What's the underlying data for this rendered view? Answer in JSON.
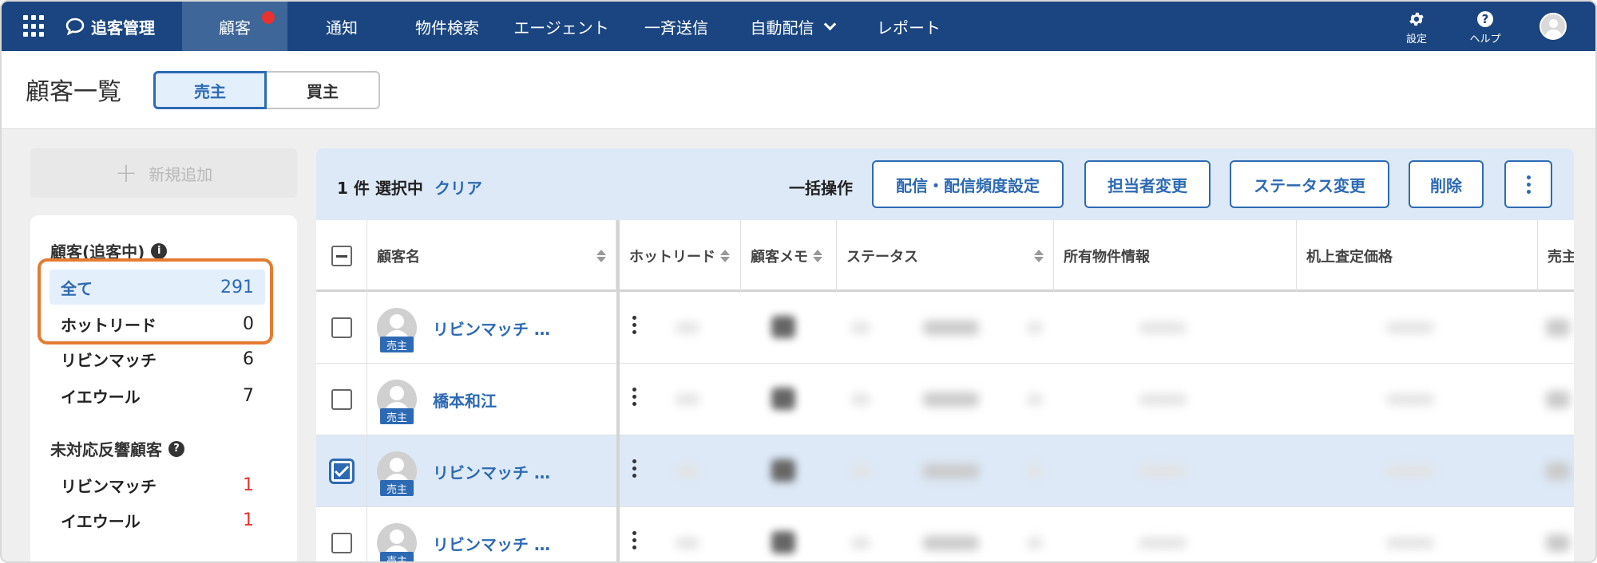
{
  "app": {
    "brand": "追客管理",
    "nav": [
      {
        "label": "顧客",
        "active": true,
        "notify": true
      },
      {
        "label": "通知"
      },
      {
        "label": "物件検索"
      },
      {
        "label": "エージェント"
      },
      {
        "label": "一斉送信"
      },
      {
        "label": "自動配信",
        "dropdown": true
      },
      {
        "label": "レポート"
      }
    ],
    "settings_label": "設定",
    "help_label": "ヘルプ",
    "help_icon": "?"
  },
  "page": {
    "title": "顧客一覧",
    "segments": [
      {
        "label": "売主",
        "selected": true
      },
      {
        "label": "買主",
        "selected": false
      }
    ]
  },
  "sidebar": {
    "add_label": "新規追加",
    "add_plus": "+",
    "section1": {
      "title": "顧客(追客中)",
      "info_icon": "i",
      "items": [
        {
          "label": "全て",
          "count": "291",
          "selected": true
        },
        {
          "label": "ホットリード",
          "count": "0"
        },
        {
          "label": "リビンマッチ",
          "count": "6"
        },
        {
          "label": "イエウール",
          "count": "7"
        }
      ]
    },
    "section2": {
      "title": "未対応反響顧客",
      "info_icon": "?",
      "items": [
        {
          "label": "リビンマッチ",
          "count": "1"
        },
        {
          "label": "イエウール",
          "count": "1"
        }
      ]
    }
  },
  "toolbar": {
    "selected_text": "1 件 選択中",
    "clear_label": "クリア",
    "bulk_label": "一括操作",
    "buttons": [
      "配信・配信頻度設定",
      "担当者変更",
      "ステータス変更",
      "削除"
    ]
  },
  "table": {
    "columns": [
      "顧客名",
      "ホットリード",
      "顧客メモ",
      "ステータス",
      "所有物件情報",
      "机上査定価格",
      "売主"
    ],
    "rows": [
      {
        "name": "リビンマッチ …",
        "badge": "売主",
        "checked": false
      },
      {
        "name": "橋本和江",
        "badge": "売主",
        "checked": false
      },
      {
        "name": "リビンマッチ …",
        "badge": "売主",
        "checked": true
      },
      {
        "name": "リビンマッチ …",
        "badge": "売主",
        "checked": false
      }
    ]
  },
  "colors": {
    "nav_bg": "#1a4580",
    "accent": "#2d6ab3",
    "highlight": "#e47b31",
    "alert": "#e8322e"
  }
}
